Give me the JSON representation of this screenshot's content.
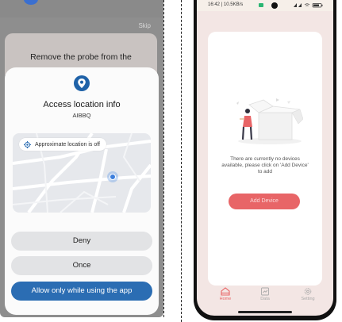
{
  "left_screen": {
    "skip_label": "Skip",
    "bg_card_text": "Remove the probe from the",
    "permission_dialog": {
      "icon": "location-pin-icon",
      "title": "Access location info",
      "app_name": "AIBBQ",
      "map_pill_text": "Approximate location is off",
      "buttons": {
        "deny": "Deny",
        "once": "Once",
        "allow": "Allow only while using the app"
      }
    }
  },
  "right_screen": {
    "status_bar": {
      "left_text": "16:42 | 10.5KB/s",
      "right_text": "¹℡"
    },
    "empty_state": {
      "message": "There are currently no devices available, please click on 'Add Device' to add",
      "button_label": "Add Device"
    },
    "tab_bar": {
      "items": [
        {
          "label": "Home",
          "icon": "home-icon",
          "active": true
        },
        {
          "label": "Data",
          "icon": "data-icon",
          "active": false
        },
        {
          "label": "Setting",
          "icon": "gear-icon",
          "active": false
        }
      ]
    }
  },
  "colors": {
    "accent_red": "#e86567",
    "allow_blue": "#2b6db3",
    "card_bg": "#f3e6e4"
  }
}
